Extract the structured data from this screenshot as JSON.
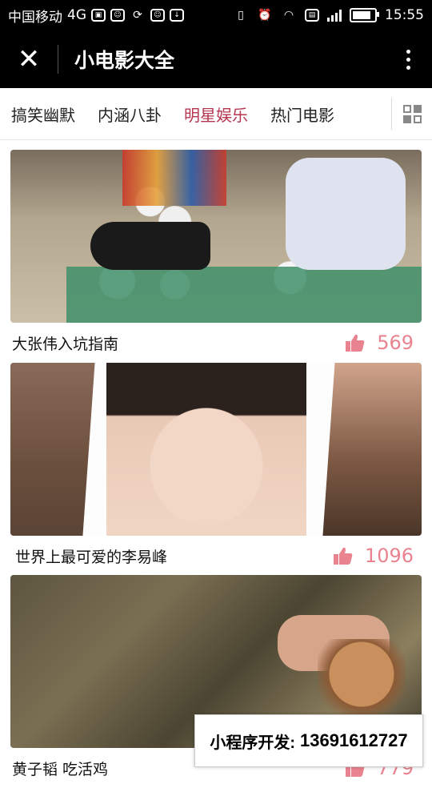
{
  "status_bar": {
    "carrier": "中国移动",
    "network": "4G",
    "time": "15:55",
    "battery_level": 0.85,
    "icons": [
      "gallery-icon",
      "bot-icon",
      "sync-icon",
      "bot-icon",
      "download-icon",
      "vibrate-icon",
      "alarm-icon",
      "wifi-icon",
      "sim-icon",
      "signal-icon",
      "battery-icon"
    ]
  },
  "header": {
    "title": "小电影大全",
    "close_icon": "close-icon",
    "more_icon": "more-vertical-icon"
  },
  "tabs": {
    "items": [
      "搞笑幽默",
      "内涵八卦",
      "明星娱乐",
      "热门电影"
    ],
    "active_index": 2,
    "active_color": "#b5364f",
    "grid_icon": "grid-icon"
  },
  "feed": [
    {
      "title": "大张伟入坑指南",
      "likes": "569"
    },
    {
      "title": "世界上最可爱的李易峰",
      "likes": "1096"
    },
    {
      "title": "黄子韬 吃活鸡",
      "likes": "779"
    }
  ],
  "banner": {
    "label": "小程序开发:",
    "phone": "13691612727"
  },
  "colors": {
    "like": "#e9838f",
    "header_bg": "#000000"
  }
}
